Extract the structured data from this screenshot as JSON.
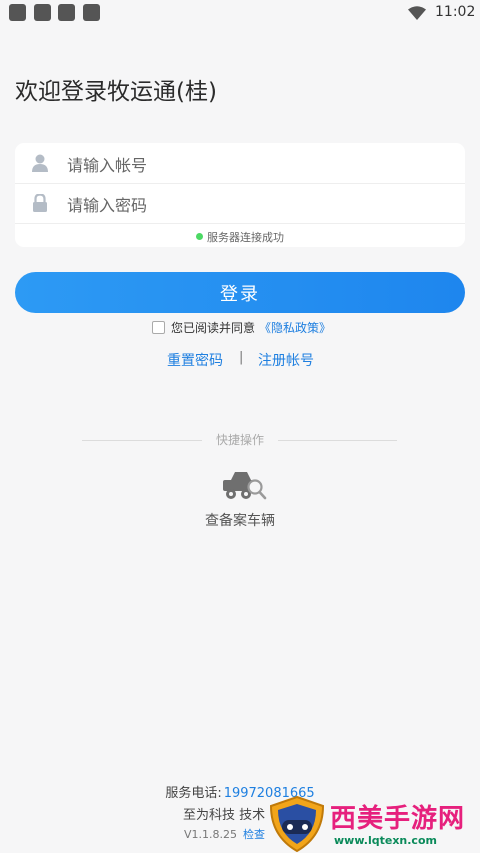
{
  "status_bar": {
    "time": "11:02"
  },
  "page": {
    "welcome_title": "欢迎登录牧运通(桂)"
  },
  "form": {
    "account_placeholder": "请输入帐号",
    "password_placeholder": "请输入密码",
    "server_status": "服务器连接成功",
    "account_icon": "user-icon",
    "password_icon": "lock-icon"
  },
  "login": {
    "button_label": "登录"
  },
  "agreement": {
    "text": "您已阅读并同意",
    "privacy_link": "《隐私政策》"
  },
  "links": {
    "reset_password": "重置密码",
    "separator": "|",
    "register": "注册帐号"
  },
  "quick_actions": {
    "title": "快捷操作",
    "items": [
      {
        "label": "查备案车辆",
        "icon": "truck-search-icon"
      }
    ]
  },
  "footer": {
    "phone_label": "服务电话:",
    "phone_number": "19972081665",
    "company": "至为科技 技术",
    "version": "V1.1.8.25",
    "check_update": "检查"
  },
  "watermark": {
    "text": "西美手游网",
    "subtext": "www.lqtexn.com"
  },
  "colors": {
    "accent": "#1e86ee",
    "link": "#1e7fe0",
    "background": "#f6f6f7",
    "status_ok": "#4cd964"
  }
}
